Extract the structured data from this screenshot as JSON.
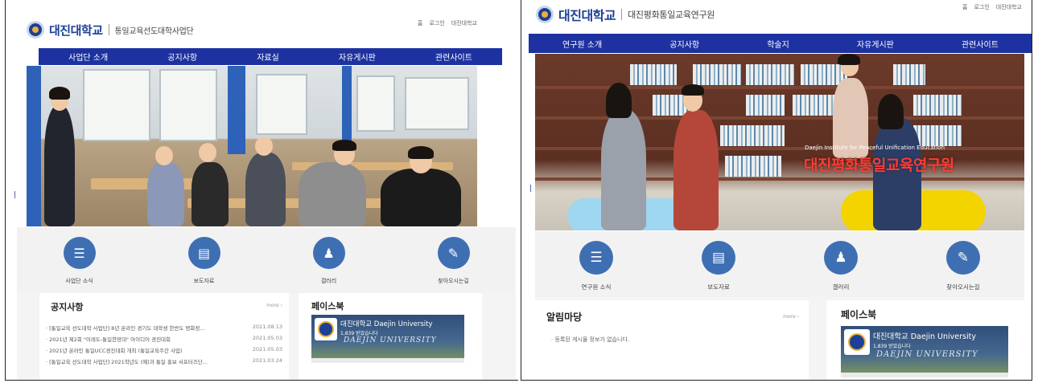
{
  "left": {
    "university": "대진대학교",
    "subtitle": "통일교육선도대학사업단",
    "util": [
      "홈",
      "로그인",
      "대진대학교"
    ],
    "nav": [
      "사업단 소개",
      "공지사항",
      "자료실",
      "자유게시판",
      "관련사이트"
    ],
    "quick": [
      {
        "label": "사업단 소식",
        "icon": "stack-icon"
      },
      {
        "label": "보도자료",
        "icon": "book-icon"
      },
      {
        "label": "갤러리",
        "icon": "person-icon"
      },
      {
        "label": "찾아오시는길",
        "icon": "pen-icon"
      }
    ],
    "notice": {
      "title": "공지사항",
      "more": "more ›",
      "items": [
        {
          "text": "· [통일교육 선도대학 사업단] 8년 온라인 경기도 대학생 한반도 평화정...",
          "date": "2021.08.13"
        },
        {
          "text": "· 2021년 제2회 \"이래도-통일한망대\" 아이디어 경진대회",
          "date": "2021.05.03"
        },
        {
          "text": "· 2021년 온라인 통일UCC경진대회 개최 (통일교육주간 사업)",
          "date": "2021.05.03"
        },
        {
          "text": "· [통일교육 선도대학 사업단] 2021학년도 (예)과 통일 홍보 서포터즈단...",
          "date": "2021.03.24"
        }
      ]
    },
    "facebook": {
      "title": "페이스북",
      "page_name": "대진대학교 Daejin University",
      "likes": "1,839 받았습니다",
      "watermark": "DAEJIN UNIVERSITY"
    }
  },
  "right": {
    "university": "대진대학교",
    "subtitle": "대진평화통일교육연구원",
    "util": [
      "홈",
      "로그인",
      "대진대학교"
    ],
    "nav": [
      "연구원 소개",
      "공지사항",
      "학술지",
      "자유게시판",
      "관련사이트"
    ],
    "hero": {
      "title_en": "Daejin Institute for Peaceful Unification Education",
      "title_ko": "대진평화통일교육연구원"
    },
    "quick": [
      {
        "label": "연구원 소식",
        "icon": "stack-icon"
      },
      {
        "label": "보도자료",
        "icon": "book-icon"
      },
      {
        "label": "갤러리",
        "icon": "person-icon"
      },
      {
        "label": "찾아오시는길",
        "icon": "pen-icon"
      }
    ],
    "notice": {
      "title": "알림마당",
      "more": "more ›",
      "empty": "· 등록된 게시물 정보가 없습니다."
    },
    "facebook": {
      "title": "페이스북",
      "page_name": "대진대학교 Daejin University",
      "likes": "1,839 받았습니다",
      "watermark": "DAEJIN UNIVERSITY"
    }
  },
  "colors": {
    "nav": "#1d32a0",
    "brand": "#1d3f95",
    "hero_title": "#ff3b34",
    "quick_icon": "#3f6fb3"
  }
}
